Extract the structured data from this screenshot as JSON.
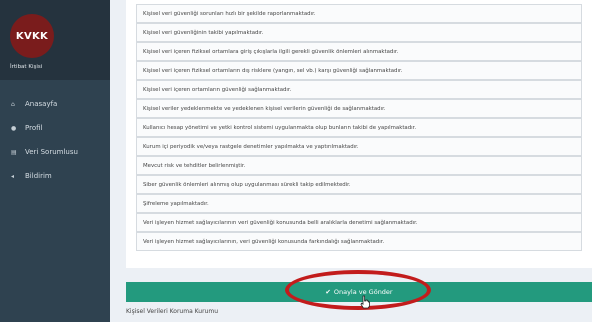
{
  "sidebar": {
    "logo_text": "KVKK",
    "user_label": "İrtibat Kişisi",
    "items": [
      {
        "icon": "home-icon",
        "glyph": "⌂",
        "label": "Anasayfa"
      },
      {
        "icon": "user-icon",
        "glyph": "●",
        "label": "Profil"
      },
      {
        "icon": "document-icon",
        "glyph": "▤",
        "label": "Veri Sorumlusu"
      },
      {
        "icon": "bell-icon",
        "glyph": "◂",
        "label": "Bildirim"
      }
    ]
  },
  "list": {
    "rows": [
      "Kişisel veri güvenliği sorunları hızlı bir şekilde raporlanmaktadır.",
      "Kişisel veri güvenliğinin takibi yapılmaktadır.",
      "Kişisel veri içeren fiziksel ortamlara giriş çıkışlarla ilgili gerekli güvenlik önlemleri alınmaktadır.",
      "Kişisel veri içeren fiziksel ortamların dış risklere (yangın, sel vb.) karşı güvenliği sağlanmaktadır.",
      "Kişisel veri içeren ortamların güvenliği sağlanmaktadır.",
      "Kişisel veriler yedeklenmekte ve yedeklenen kişisel verilerin güvenliği de sağlanmaktadır.",
      "Kullanıcı hesap yönetimi ve yetki kontrol sistemi uygulanmakta olup bunların takibi de yapılmaktadır.",
      "Kurum içi periyodik ve/veya rastgele denetimler yapılmakta ve yaptırılmaktadır.",
      "Mevcut risk ve tehditler belirlenmiştir.",
      "Siber güvenlik önlemleri alınmış olup uygulanması sürekli takip edilmektedir.",
      "Şifreleme yapılmaktadır.",
      "Veri işleyen hizmet sağlayıcılarının veri güvenliği konusunda belli aralıklarla denetimi sağlanmaktadır.",
      "Veri işleyen hizmet sağlayıcılarının, veri güvenliği konusunda farkındalığı sağlanmaktadır."
    ]
  },
  "submit": {
    "label": "Onayla ve Gönder",
    "icon": "check-icon"
  },
  "footer": {
    "text": "Kişisel Verileri Koruma Kurumu"
  },
  "colors": {
    "sidebar": "#2f4250",
    "button": "#239a7e",
    "highlight": "#c21c1c"
  }
}
